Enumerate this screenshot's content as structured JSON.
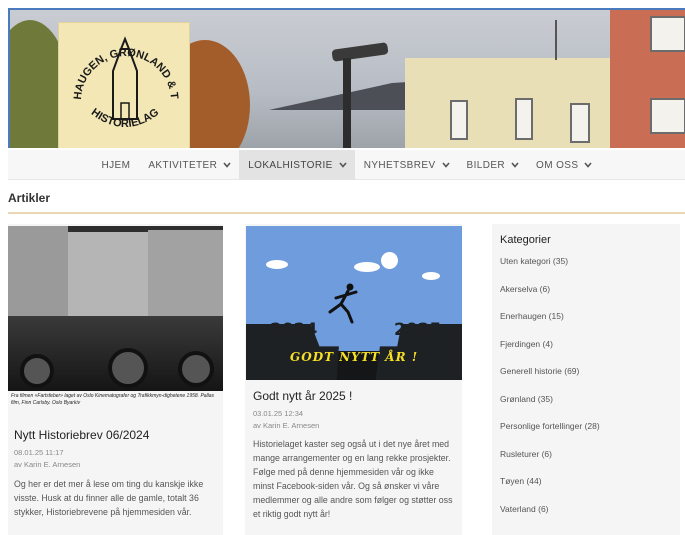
{
  "logo": {
    "text_top": "ENERHAUGEN, GRØNLAND & TØYEN",
    "text_bottom": "HISTORIELAG"
  },
  "nav": {
    "items": [
      {
        "label": "HJEM",
        "dropdown": false,
        "active": false
      },
      {
        "label": "AKTIVITETER",
        "dropdown": true,
        "active": false
      },
      {
        "label": "LOKALHISTORIE",
        "dropdown": true,
        "active": true
      },
      {
        "label": "NYHETSBREV",
        "dropdown": true,
        "active": false
      },
      {
        "label": "BILDER",
        "dropdown": true,
        "active": false
      },
      {
        "label": "OM OSS",
        "dropdown": true,
        "active": false
      }
    ]
  },
  "section": {
    "title": "Artikler"
  },
  "articles": [
    {
      "image_caption": "Fra filmen «Fartsfeber» laget av Oslo Kinematografer og Trafikkmyn-dighetene 1958. Pallas film, Finn Carlsby. Oslo Byarkiv",
      "title": "Nytt Historiebrev 06/2024",
      "date": "08.01.25 11:17",
      "author": "av Karin E. Arnesen",
      "excerpt": "Og her er det mer å lese om ting du kanskje ikke visste. Husk at du finner alle de gamle, totalt 36 stykker, Historiebrevene på hjemmesiden vår."
    },
    {
      "image_year_left": "2024",
      "image_year_right": "2025",
      "image_greeting": "GODT NYTT ÅR !",
      "title": "Godt nytt år 2025 !",
      "date": "03.01.25 12:34",
      "author": "av Karin E. Arnesen",
      "excerpt": "Historielaget kaster seg også ut i det nye året med mange arrangementer og en lang rekke prosjekter. Følge med på denne hjemmesiden vår og ikke minst Facebook-siden vår. Og så ønsker vi våre medlemmer og alle andre som følger og støtter oss et riktig godt nytt år!"
    }
  ],
  "sidebar": {
    "title": "Kategorier",
    "categories": [
      "Uten kategori (35)",
      "Akerselva (6)",
      "Enerhaugen (15)",
      "Fjerdingen (4)",
      "Generell historie (69)",
      "Grønland (35)",
      "Personlige fortellinger (28)",
      "Rusleturer (6)",
      "Tøyen (44)",
      "Vaterland (6)"
    ]
  },
  "colors": {
    "nav_active": "#e3e3e3",
    "section_line": "#ead8b4",
    "greeting": "#f7e024",
    "sky": "#6e9cdc"
  }
}
